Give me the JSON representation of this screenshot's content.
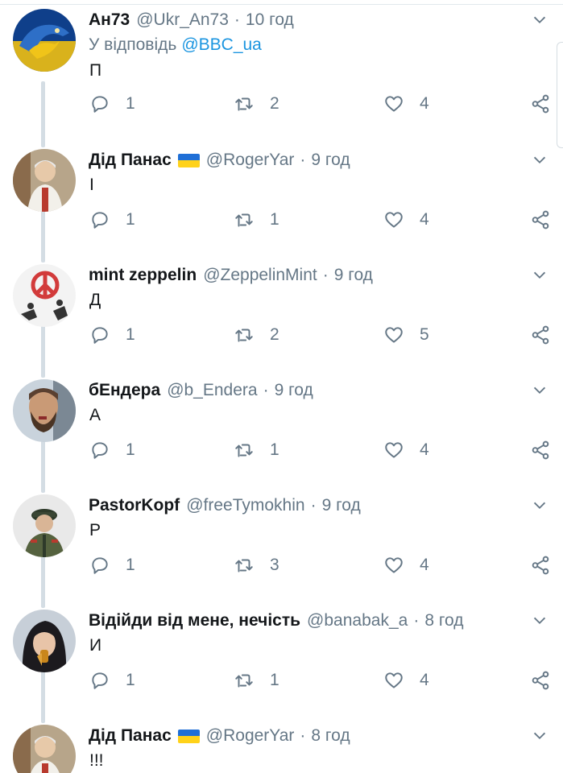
{
  "colors": {
    "text": "#14171a",
    "secondary": "#657786",
    "link": "#1b95e0",
    "thread_line": "#d4dde4",
    "flag_blue": "#1f6fd6",
    "flag_yellow": "#ffd21a"
  },
  "icons": [
    "reply-icon",
    "retweet-icon",
    "like-icon",
    "share-icon",
    "chevron-down-icon"
  ],
  "tweets": [
    {
      "name": "Ан73",
      "flag": false,
      "handle": "@Ukr_An73",
      "dot": "·",
      "time": "10 год",
      "reply_to_label": "У відповідь",
      "reply_to_handle": "@BBC_ua",
      "text": "П",
      "replies": "1",
      "retweets": "2",
      "likes": "4"
    },
    {
      "name": "Дід Панас",
      "flag": true,
      "handle": "@RogerYar",
      "dot": "·",
      "time": "9 год",
      "text": "І",
      "replies": "1",
      "retweets": "1",
      "likes": "4"
    },
    {
      "name": "mint zeppelin",
      "flag": false,
      "handle": "@ZeppelinMint",
      "dot": "·",
      "time": "9 год",
      "text": "Д",
      "replies": "1",
      "retweets": "2",
      "likes": "5"
    },
    {
      "name": "бЕндера",
      "flag": false,
      "handle": "@b_Endera",
      "dot": "·",
      "time": "9 год",
      "text": "А",
      "replies": "1",
      "retweets": "1",
      "likes": "4"
    },
    {
      "name": "PastorKopf",
      "flag": false,
      "handle": "@freeTymokhin",
      "dot": "·",
      "time": "9 год",
      "text": "Р",
      "replies": "1",
      "retweets": "3",
      "likes": "4"
    },
    {
      "name": "Відійди від мене, нечість",
      "flag": false,
      "handle": "@banabak_a",
      "dot": "·",
      "time": "8 год",
      "text": "И",
      "replies": "1",
      "retweets": "1",
      "likes": "4"
    },
    {
      "name": "Дід Панас",
      "flag": true,
      "handle": "@RogerYar",
      "dot": "·",
      "time": "8 год",
      "text": "!!!"
    }
  ]
}
